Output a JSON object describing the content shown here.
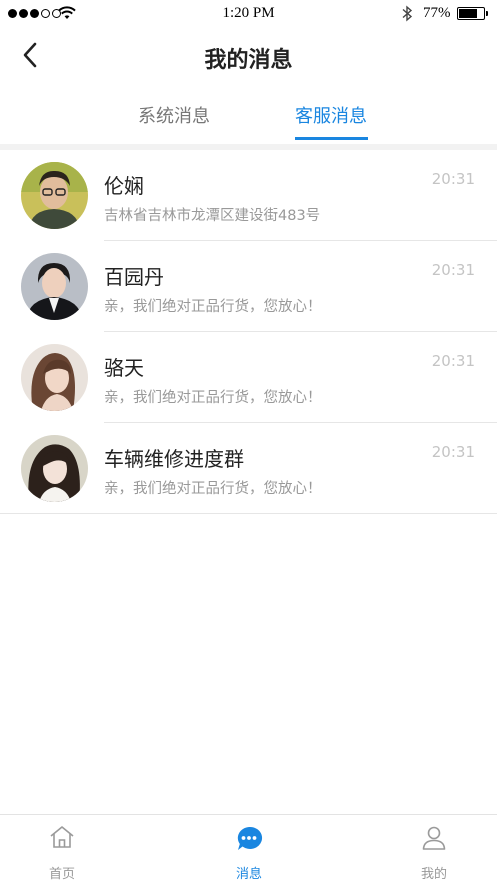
{
  "status_bar": {
    "time": "1:20 PM",
    "battery": "77%",
    "battery_level": 0.77,
    "signal_bars_filled": 3,
    "signal_bars_total": 5
  },
  "nav": {
    "title": "我的消息"
  },
  "tabs": [
    {
      "label": "系统消息",
      "active": false
    },
    {
      "label": "客服消息",
      "active": true
    }
  ],
  "conversations": [
    {
      "name": "伦娴",
      "message": "吉林省吉林市龙潭区建设街483号",
      "time": "20:31"
    },
    {
      "name": "百园丹",
      "message": "亲，我们绝对正品行货，您放心！",
      "time": "20:31"
    },
    {
      "name": "骆天",
      "message": "亲，我们绝对正品行货，您放心！",
      "time": "20:31"
    },
    {
      "name": "车辆维修进度群",
      "message": "亲，我们绝对正品行货，您放心！",
      "time": "20:31"
    }
  ],
  "tabbar": {
    "items": [
      {
        "label": "首页",
        "icon": "home-icon",
        "active": false
      },
      {
        "label": "消息",
        "icon": "message-bubble-icon",
        "active": true
      },
      {
        "label": "我的",
        "icon": "user-icon",
        "active": false
      }
    ]
  },
  "colors": {
    "accent": "#1a86e0",
    "secondary_text": "#999999",
    "time_text": "#c4c4c4"
  }
}
